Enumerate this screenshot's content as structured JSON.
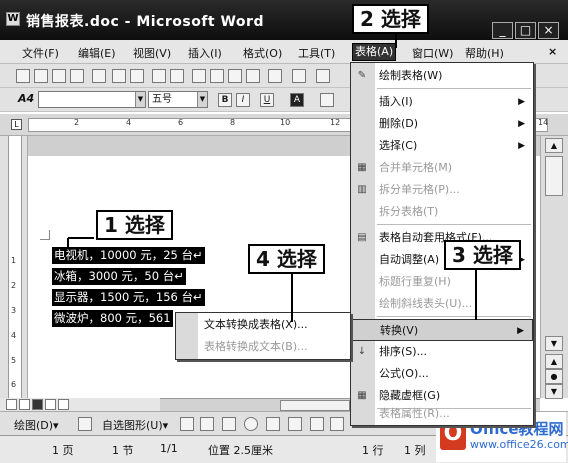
{
  "window": {
    "title": "销售报表.doc - Microsoft Word",
    "controls": [
      "_",
      "□",
      "×"
    ]
  },
  "menubar": {
    "items": [
      "文件(F)",
      "编辑(E)",
      "视图(V)",
      "插入(I)",
      "格式(O)",
      "工具(T)",
      "表格(A)",
      "窗口(W)",
      "帮助(H)"
    ],
    "close": "×"
  },
  "format_bar": {
    "style_icon": "A4",
    "font_size": "五号",
    "bold": "B",
    "italic": "I",
    "underline": "U",
    "font_color": "A"
  },
  "ruler": {
    "ticks": [
      "2",
      "4",
      "6",
      "8",
      "10",
      "12",
      "14"
    ]
  },
  "vruler": {
    "ticks": [
      "1",
      "2",
      "3",
      "4",
      "5",
      "6"
    ]
  },
  "document": {
    "lines": [
      "电视机，10000 元，25 台↵",
      "冰箱，3000 元，50 台↵",
      "显示器，1500 元，156 台↵",
      "微波炉，800 元，561"
    ]
  },
  "table_menu": {
    "items": [
      {
        "label": "绘制表格(W)",
        "state": "enabled",
        "submenu": false,
        "icon": "pencil-icon"
      },
      {
        "label": "插入(I)",
        "state": "enabled",
        "submenu": true
      },
      {
        "label": "删除(D)",
        "state": "enabled",
        "submenu": true
      },
      {
        "label": "选择(C)",
        "state": "enabled",
        "submenu": true
      },
      {
        "label": "合并单元格(M)",
        "state": "disabled",
        "submenu": false,
        "icon": "merge-icon"
      },
      {
        "label": "拆分单元格(P)...",
        "state": "disabled",
        "submenu": false,
        "icon": "split-icon"
      },
      {
        "label": "拆分表格(T)",
        "state": "disabled",
        "submenu": false
      },
      {
        "label": "表格自动套用格式(F)...",
        "state": "enabled",
        "submenu": false,
        "icon": "autoformat-icon"
      },
      {
        "label": "自动调整(A)",
        "state": "enabled",
        "submenu": true
      },
      {
        "label": "标题行重复(H)",
        "state": "disabled",
        "submenu": false
      },
      {
        "label": "绘制斜线表头(U)...",
        "state": "disabled",
        "submenu": false
      },
      {
        "label": "转换(V)",
        "state": "highlighted",
        "submenu": true
      },
      {
        "label": "排序(S)...",
        "state": "enabled",
        "submenu": false,
        "icon": "sort-icon"
      },
      {
        "label": "公式(O)...",
        "state": "enabled",
        "submenu": false
      },
      {
        "label": "隐藏虚框(G)",
        "state": "enabled",
        "submenu": false,
        "icon": "grid-icon"
      },
      {
        "label": "表格属性(R)...",
        "state": "disabled",
        "submenu": false
      }
    ]
  },
  "convert_menu": {
    "items": [
      {
        "label": "文本转换成表格(X)...",
        "state": "enabled"
      },
      {
        "label": "表格转换成文本(B)...",
        "state": "disabled"
      }
    ]
  },
  "callouts": {
    "step1": "1 选择",
    "step2": "2 选择",
    "step3": "3 选择",
    "step4": "4 选择"
  },
  "drawing_bar": {
    "draw": "绘图(D)▾",
    "autoshapes": "自选图形(U)▾"
  },
  "status": {
    "page": "1 页",
    "section": "1 节",
    "pages": "1/1",
    "position": "位置 2.5厘米",
    "line": "1 行",
    "col": "1 列"
  },
  "watermark": {
    "logo": "O",
    "text": "Office教程网",
    "url": "www.office26.com"
  }
}
